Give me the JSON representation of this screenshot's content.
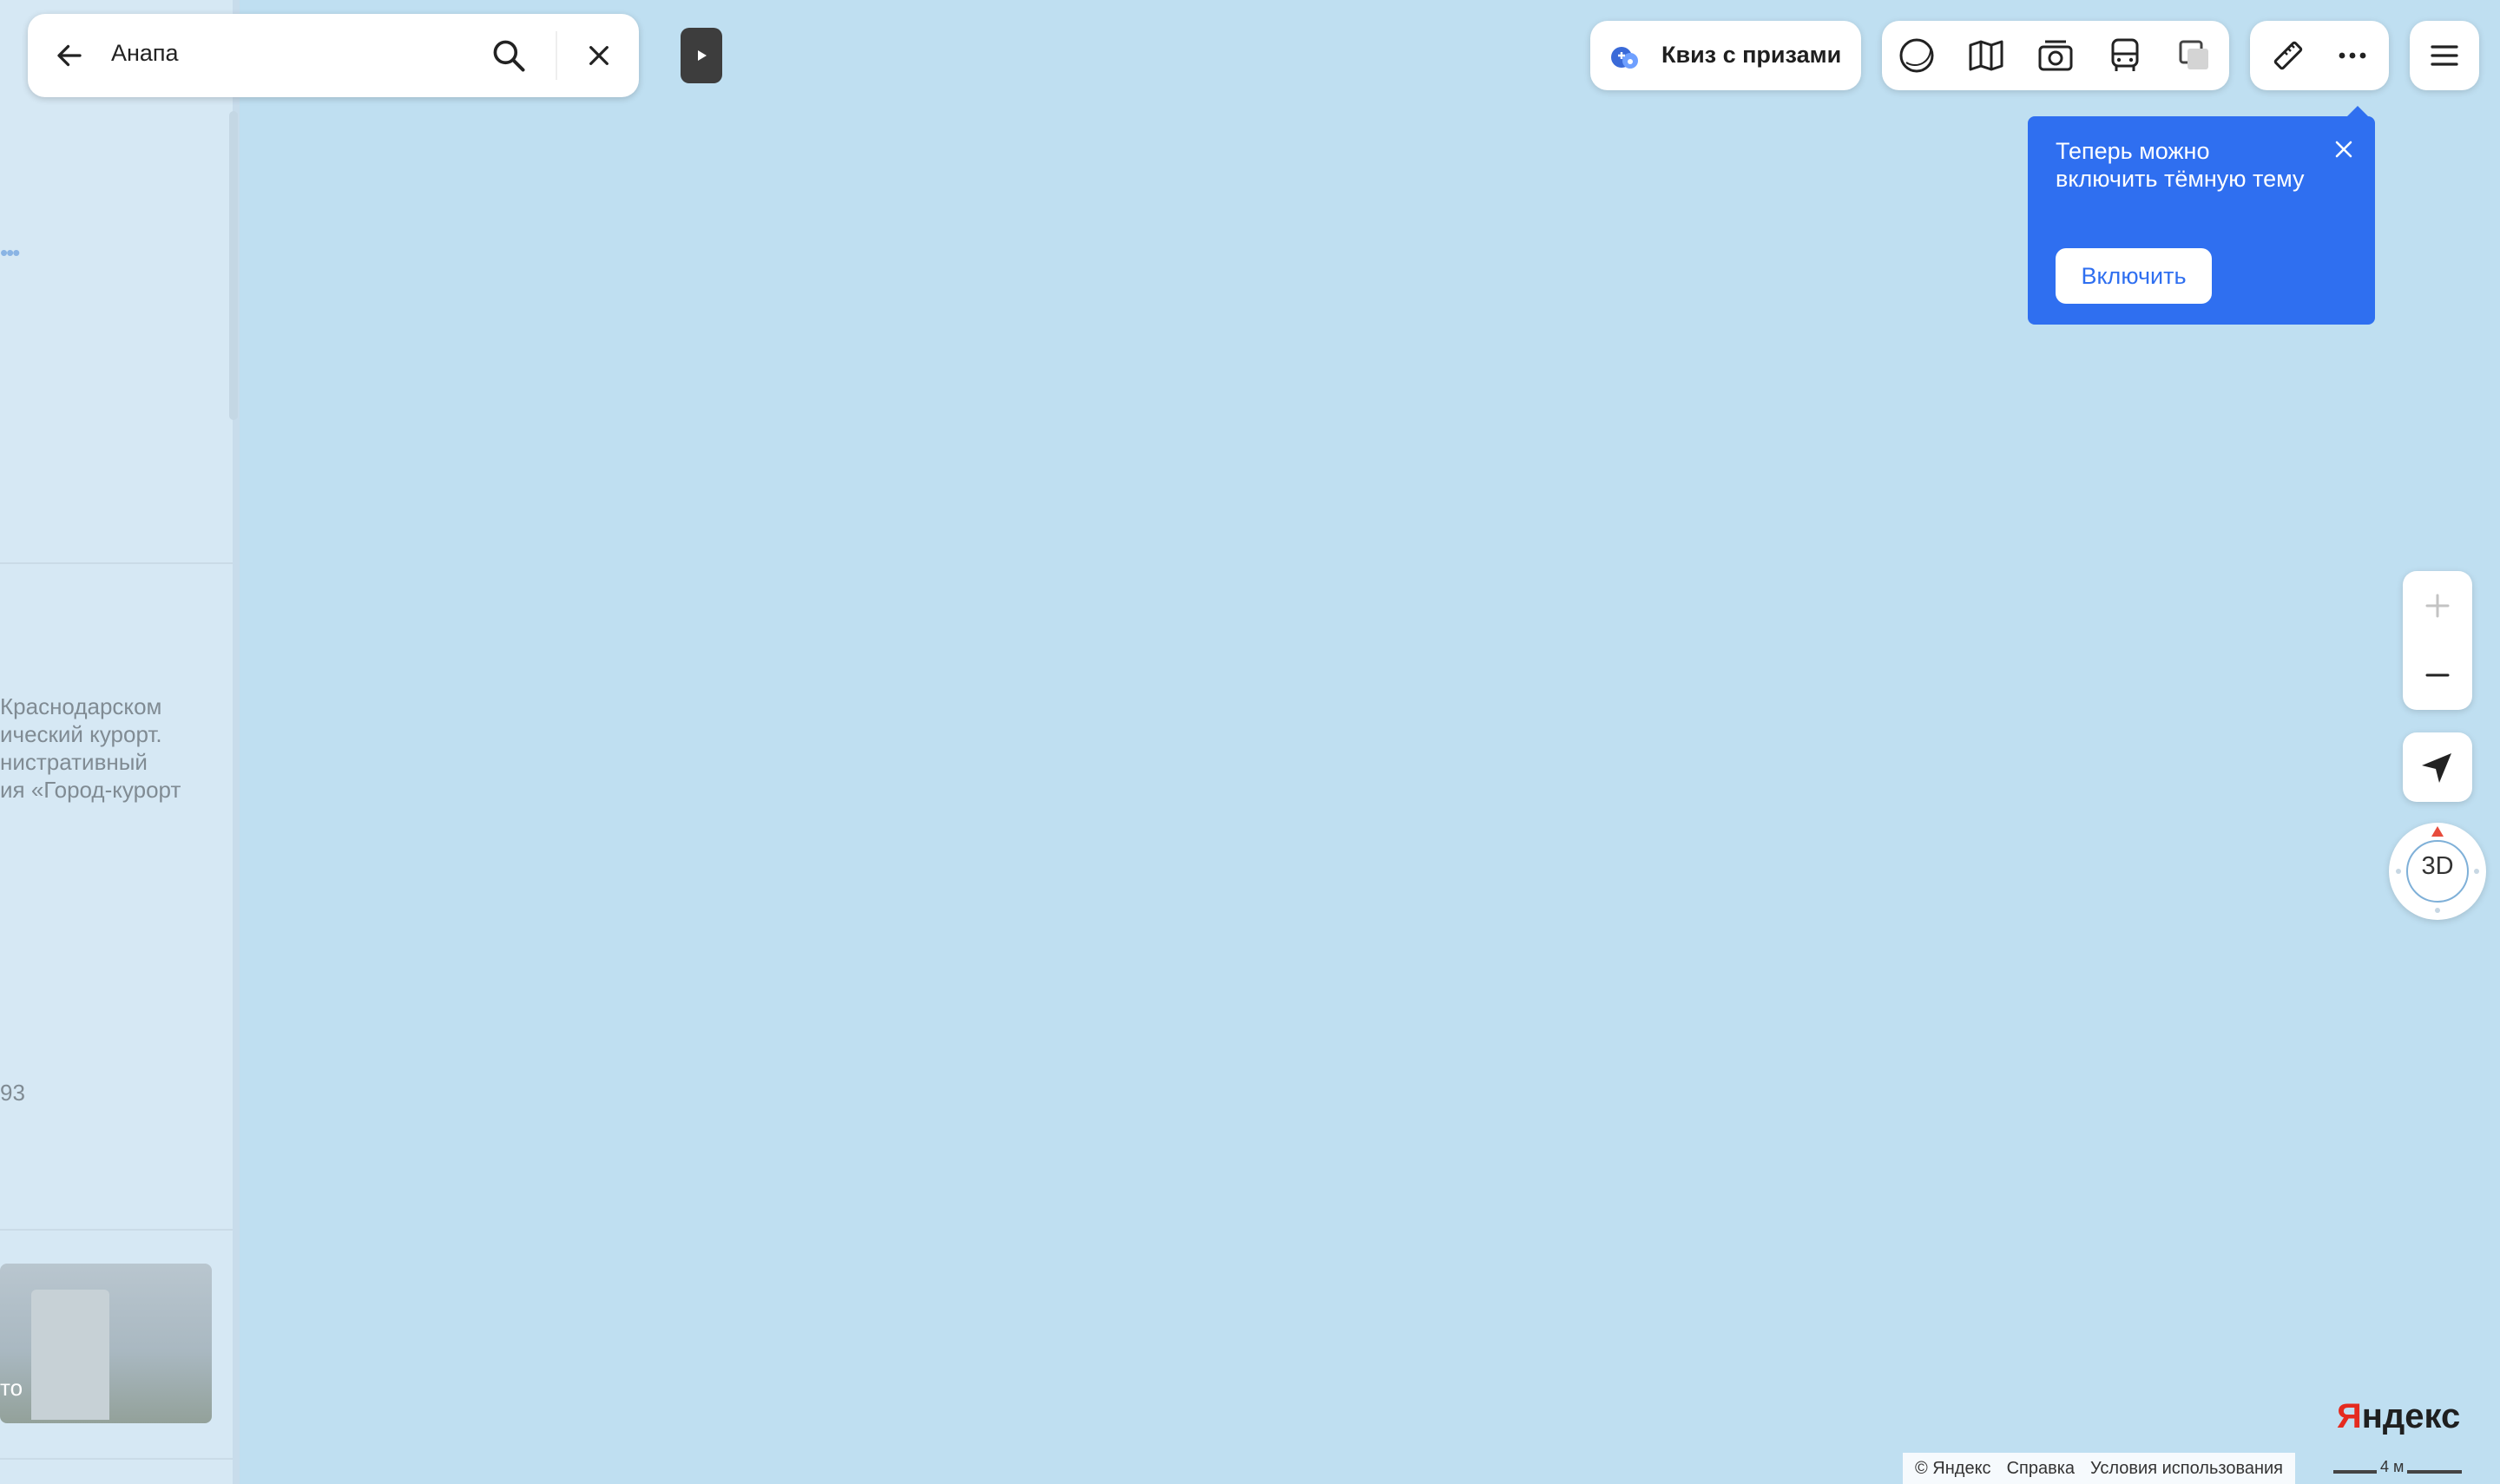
{
  "search": {
    "query": "Анапа"
  },
  "panel": {
    "desc_lines": [
      "Краснодарском",
      "ический курорт.",
      "нистративный",
      "ия «Город-курорт"
    ],
    "number": "93",
    "photo_label": "то",
    "dots": "•••"
  },
  "toolbar": {
    "quiz_label": "Квиз с призами",
    "layer_icons": [
      "circle-layer-icon",
      "map-book-icon",
      "camera-icon",
      "bus-icon",
      "layers-square-icon"
    ],
    "tool_icons": [
      "ruler-icon",
      "more-dots-icon"
    ]
  },
  "tooltip": {
    "text": "Теперь можно включить тёмную тему",
    "button": "Включить"
  },
  "controls": {
    "compass_label": "3D"
  },
  "footer": {
    "logo_first": "Я",
    "logo_rest": "ндекс",
    "attribution": [
      "© Яндекс",
      "Справка",
      "Условия использования"
    ],
    "scale": "4 м"
  },
  "colors": {
    "map_water": "#bfdff1",
    "accent": "#2f6ff0",
    "logo_red": "#e52b1f"
  }
}
